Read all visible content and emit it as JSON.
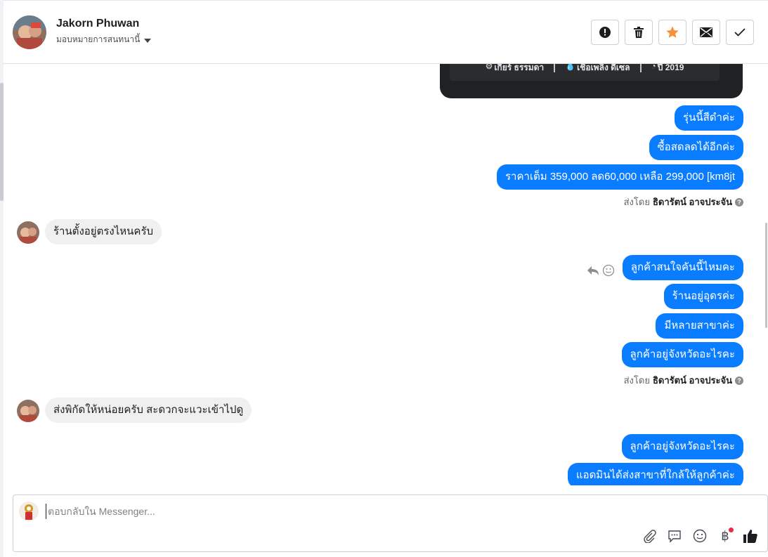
{
  "header": {
    "contact_name": "Jakorn Phuwan",
    "assign_label": "มอบหมายการสนทนานี้",
    "buttons": {
      "spam": "alert-icon",
      "delete": "trash-icon",
      "star": "star-icon",
      "mark_unread": "envelope-icon",
      "done": "check-icon"
    },
    "star_color": "#f7923b"
  },
  "card": {
    "spec_gear": "เกียร์ ธรรมดา",
    "spec_fuel": "เชื้อเพลิง ดีเซล",
    "spec_year": "ปี 2019"
  },
  "messages": {
    "m1": "รุ่นนี้สีดำค่ะ",
    "m2": "ซื้อสดลดได้อีกค่ะ",
    "m3": "ราคาเต็ม 359,000 ลด60,000 เหลือ 299,000 [km8jt",
    "sent_by_1_prefix": "ส่งโดย",
    "sent_by_1_name": "ธิดารัตน์ อาจประจัน",
    "in1": "ร้านตั้งอยู่ตรงไหนครับ",
    "m4": "ลูกค้าสนใจคันนี้ไหมคะ",
    "m5": "ร้านอยู่อุดรค่ะ",
    "m6": "มีหลายสาขาค่ะ",
    "m7": "ลูกค้าอยู่จังหวัดอะไรคะ",
    "sent_by_2_prefix": "ส่งโดย",
    "sent_by_2_name": "ธิดารัตน์ อาจประจัน",
    "in2": "ส่งพิกัดให้หน่อยครับ สะดวกจะแวะเข้าไปดู",
    "m8": "ลูกค้าอยู่จังหวัดอะไรคะ",
    "m9": "แอดมินได้ส่งสาขาที่ใกล้ให้ลูกค้าค่ะ"
  },
  "composer": {
    "placeholder": "ตอบกลับใน Messenger...",
    "tools": [
      "paperclip-icon",
      "saved-reply-icon",
      "emoji-icon",
      "baht-payment-icon",
      "thumbs-up-icon"
    ]
  },
  "colors": {
    "outgoing_bubble": "#0a7cff",
    "incoming_bubble": "#f0f0f0"
  }
}
